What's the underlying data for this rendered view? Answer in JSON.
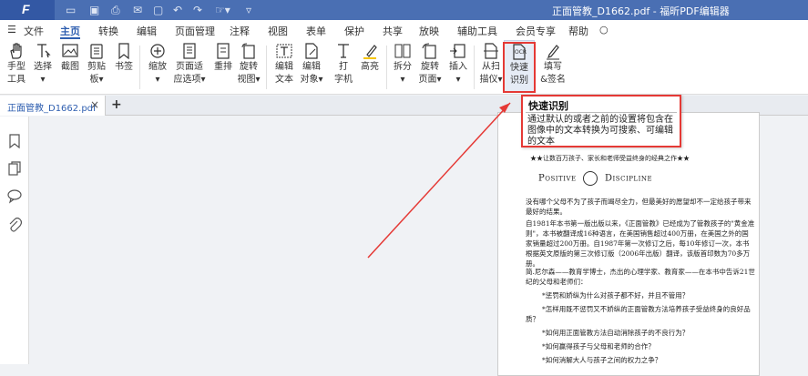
{
  "window": {
    "title": "正面管教_D1662.pdf - 福昕PDF编辑器",
    "logo_letter": "F"
  },
  "menu": {
    "items": [
      "文件",
      "主页",
      "转换",
      "编辑",
      "页面管理",
      "注释",
      "视图",
      "表单",
      "保护",
      "共享",
      "放映",
      "辅助工具",
      "会员专享",
      "帮助"
    ],
    "active": "主页"
  },
  "ribbon": {
    "buttons": [
      {
        "line1": "手型",
        "line2": "工具"
      },
      {
        "line1": "选择",
        "line2": "▾"
      },
      {
        "line1": "截图",
        "line2": ""
      },
      {
        "line1": "剪贴",
        "line2": "板▾"
      },
      {
        "line1": "书签",
        "line2": ""
      },
      {
        "line1": "缩放",
        "line2": "▾"
      },
      {
        "line1": "页面适",
        "line2": "应选项▾"
      },
      {
        "line1": "重排",
        "line2": ""
      },
      {
        "line1": "旋转",
        "line2": "视图▾"
      },
      {
        "line1": "编辑",
        "line2": "文本"
      },
      {
        "line1": "编辑",
        "line2": "对象▾"
      },
      {
        "line1": "打",
        "line2": "字机"
      },
      {
        "line1": "高亮",
        "line2": ""
      },
      {
        "line1": "拆分",
        "line2": "▾"
      },
      {
        "line1": "旋转",
        "line2": "页面▾"
      },
      {
        "line1": "插入",
        "line2": "▾"
      },
      {
        "line1": "从扫",
        "line2": "描仪▾"
      },
      {
        "line1": "快速",
        "line2": "识别"
      },
      {
        "line1": "填写",
        "line2": "&签名"
      }
    ]
  },
  "tabs": {
    "doc_tab": "正面管教_D1662.pdf",
    "close": "×",
    "add": "+"
  },
  "tooltip": {
    "title": "快速识别",
    "body": "通过默认的或者之前的设置将包含在图像中的文本转换为可搜索、可编辑的文本"
  },
  "document": {
    "header": "★★让数百万孩子、家长和老师受益终身的经典之作★★",
    "logo_left": "Positive",
    "logo_right": "Discipline",
    "para1": "没有哪个父母不为了孩子而竭尽全力，但最美好的愿望却不一定给孩子带来最好的结果。",
    "para2": "自1981年本书第一版出版以来，《正面管教》已经成为了管教孩子的\"黄金准则\"，本书被翻译成16种语言，在美国销售超过400万册，在美国之外的国家销量超过200万册。自1987年第一次修订之后，每10年修订一次，本书根据英文原版的第三次修订版（2006年出版）翻译，该版首印数为70多万册。",
    "para3": "简.尼尔森——教育学博士，杰出的心理学家、教育家——在本书中告诉21世纪的父母和老师们：",
    "q1": "*惩罚和娇纵为什么对孩子都不好，并且不管用？",
    "q2": "*怎样用既不惩罚又不娇纵的正面管教方法培养孩子受益终身的良好品质？",
    "q3": "*如何用正面管教方法自动消除孩子的不良行为？",
    "q4": "*如何赢得孩子与父母和老师的合作？",
    "q5": "*如何消解大人与孩子之间的权力之争？"
  }
}
